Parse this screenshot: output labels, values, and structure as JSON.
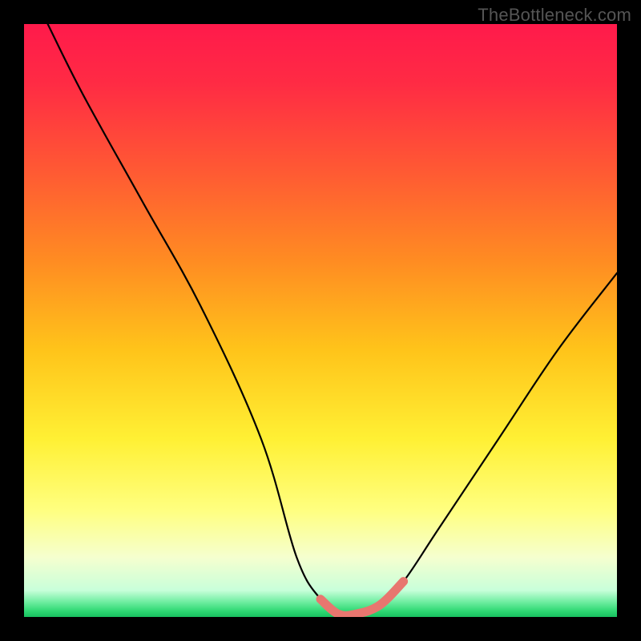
{
  "watermark": "TheBottleneck.com",
  "chart_data": {
    "type": "line",
    "title": "",
    "xlabel": "",
    "ylabel": "",
    "xlim": [
      0,
      100
    ],
    "ylim": [
      0,
      100
    ],
    "series": [
      {
        "name": "bottleneck-curve",
        "x": [
          4,
          10,
          20,
          30,
          40,
          46,
          50,
          53,
          56,
          60,
          64,
          70,
          80,
          90,
          100
        ],
        "y": [
          100,
          88,
          70,
          52,
          30,
          10,
          3,
          0.5,
          0.5,
          2,
          6,
          15,
          30,
          45,
          58
        ]
      }
    ],
    "flat_region": {
      "x_start": 47,
      "x_end": 64,
      "color": "#e8766f"
    },
    "gradient_stops": [
      {
        "offset": 0.0,
        "color": "#ff1a4b"
      },
      {
        "offset": 0.1,
        "color": "#ff2b44"
      },
      {
        "offset": 0.25,
        "color": "#ff5a33"
      },
      {
        "offset": 0.4,
        "color": "#ff8c22"
      },
      {
        "offset": 0.55,
        "color": "#ffc41a"
      },
      {
        "offset": 0.7,
        "color": "#fff034"
      },
      {
        "offset": 0.82,
        "color": "#ffff80"
      },
      {
        "offset": 0.9,
        "color": "#f5ffcf"
      },
      {
        "offset": 0.955,
        "color": "#c8ffda"
      },
      {
        "offset": 0.975,
        "color": "#6eeda0"
      },
      {
        "offset": 0.99,
        "color": "#2fd873"
      },
      {
        "offset": 1.0,
        "color": "#18c060"
      }
    ]
  }
}
